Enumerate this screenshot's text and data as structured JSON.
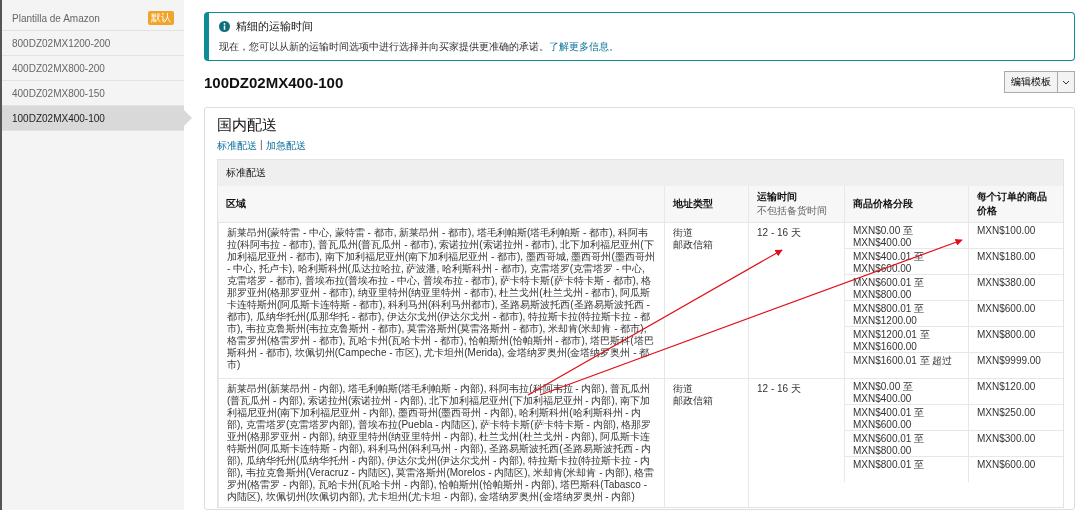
{
  "sidebar": {
    "items": [
      {
        "label": "Plantilla de Amazon",
        "badge": "默认",
        "selected": false
      },
      {
        "label": "800DZ02MX1200-200",
        "selected": false
      },
      {
        "label": "400DZ02MX800-200",
        "selected": false
      },
      {
        "label": "400DZ02MX800-150",
        "selected": false
      },
      {
        "label": "100DZ02MX400-100",
        "selected": true
      }
    ]
  },
  "notice": {
    "title": "精细的运输时间",
    "text": "现在，您可以从新的运输时间选项中进行选择并向买家提供更准确的承诺。",
    "link": "了解更多信息。"
  },
  "template": {
    "title": "100DZ02MX400-100",
    "edit_button": "编辑模板"
  },
  "domestic": {
    "title": "国内配送",
    "links": [
      "标准配送",
      "加急配送"
    ],
    "separator": "|",
    "section": "标准配送",
    "columns": [
      {
        "label": "区域"
      },
      {
        "label": "地址类型"
      },
      {
        "label": "运输时间",
        "sub": "不包括备货时间"
      },
      {
        "label": "商品价格分段"
      },
      {
        "label": "每个订单的商品价格"
      }
    ],
    "rows": [
      {
        "region": "新莱昂州(蒙特雷 - 中心, 蒙特雷 - 都市, 新莱昂州 - 都市), 塔毛利帕斯(塔毛利帕斯 - 都市), 科阿韦拉(科阿韦拉 - 都市), 普瓦瓜州(普瓦瓜州 - 都市), 索诺拉州(索诺拉州 - 都市), 北下加利福尼亚州(下加利福尼亚州 - 都市), 南下加利福尼亚州(南下加利福尼亚州 - 都市), 墨西哥城, 墨西哥州(墨西哥州 - 中心, 托卢卡), 哈利斯科州(瓜达拉哈拉, 萨波潘, 哈利斯科州 - 都市), 克雷塔罗(克雷塔罗 - 中心, 克雷塔罗 - 都市), 普埃布拉(普埃布拉 - 中心, 普埃布拉 - 都市), 萨卡特卡斯(萨卡特卡斯 - 都市), 格那罗亚州(格那罗亚州 - 都市), 纳亚里特州(纳亚里特州 - 都市), 杜兰戈州(杜兰戈州 - 都市), 阿瓜斯卡连特斯州(阿瓜斯卡连特斯 - 都市), 科利马州(科利马州都市), 圣路易斯波托西(圣路易斯波托西 - 都市), 瓜纳华托州(瓜那华托 - 都市), 伊达尔戈州(伊达尔戈州 - 都市), 特拉斯卡拉(特拉斯卡拉 - 都市), 韦拉克鲁斯州(韦拉克鲁斯州 - 都市), 莫雷洛斯州(莫雷洛斯州 - 都市), 米却肯(米却肯 - 都市), 格雷罗州(格雷罗州 - 都市), 瓦哈卡州(瓦哈卡州 - 都市), 恰帕斯州(恰帕斯州 - 都市), 塔巴斯科(塔巴斯科州 - 都市), 坎佩切州(Campeche - 市区), 尤卡坦州(Merida), 金塔纳罗奥州(金塔纳罗奥州 - 都市)",
        "address_types": [
          "街道",
          "邮政信箱"
        ],
        "transit": "12 - 16 天",
        "tiers": [
          {
            "range": "MXN$0.00 至 MXN$400.00",
            "price": "MXN$100.00"
          },
          {
            "range": "MXN$400.01 至 MXN$600.00",
            "price": "MXN$180.00"
          },
          {
            "range": "MXN$600.01 至 MXN$800.00",
            "price": "MXN$380.00"
          },
          {
            "range": "MXN$800.01 至 MXN$1200.00",
            "price": "MXN$600.00"
          },
          {
            "range": "MXN$1200.01 至 MXN$1600.00",
            "price": "MXN$800.00"
          },
          {
            "range": "MXN$1600.01 至 超过",
            "price": "MXN$9999.00"
          }
        ]
      },
      {
        "region": "新莱昂州(新莱昂州 - 内部), 塔毛利帕斯(塔毛利帕斯 - 内部), 科阿韦拉(科阿韦拉 - 内部), 普瓦瓜州(普瓦瓜州 - 内部), 索诺拉州(索诺拉州 - 内部), 北下加利福尼亚州(下加利福尼亚州 - 内部), 南下加利福尼亚州(南下加利福尼亚州 - 内部), 墨西哥州(墨西哥州 - 内部), 哈利斯科州(哈利斯科州 - 内部), 克雷塔罗(克雷塔罗内部), 普埃布拉(Puebla - 内陆区), 萨卡特卡斯(萨卡特卡斯 - 内部), 格那罗亚州(格那罗亚州 - 内部), 纳亚里特州(纳亚里特州 - 内部), 杜兰戈州(杜兰戈州 - 内部), 阿瓜斯卡连特斯州(阿瓜斯卡连特斯 - 内部), 科利马州(科利马州 - 内部), 圣路易斯波托西(圣路易斯波托西 - 内部), 瓜纳华托州(瓜纳华托州 - 内部), 伊达尔戈州(伊达尔戈州 - 内部), 特拉斯卡拉(特拉斯卡拉 - 内部), 韦拉克鲁斯州(Veracruz - 内陆区), 莫雷洛斯州(Morelos - 内陆区), 米却肯(米却肯 - 内部), 格雷罗州(格雷罗 - 内部), 瓦哈卡州(瓦哈卡州 - 内部), 恰帕斯州(恰帕斯州 - 内部), 塔巴斯科(Tabasco - 内陆区), 坎佩切州(坎佩切内部), 尤卡坦州(尤卡坦 - 内部), 金塔纳罗奥州(金塔纳罗奥州 - 内部)",
        "address_types": [
          "街道",
          "邮政信箱"
        ],
        "transit": "12 - 16 天",
        "tiers": [
          {
            "range": "MXN$0.00 至 MXN$400.00",
            "price": "MXN$120.00"
          },
          {
            "range": "MXN$400.01 至 MXN$600.00",
            "price": "MXN$250.00"
          },
          {
            "range": "MXN$600.01 至 MXN$800.00",
            "price": "MXN$300.00"
          },
          {
            "range": "MXN$800.01 至",
            "price": "MXN$600.00"
          }
        ]
      }
    ]
  }
}
